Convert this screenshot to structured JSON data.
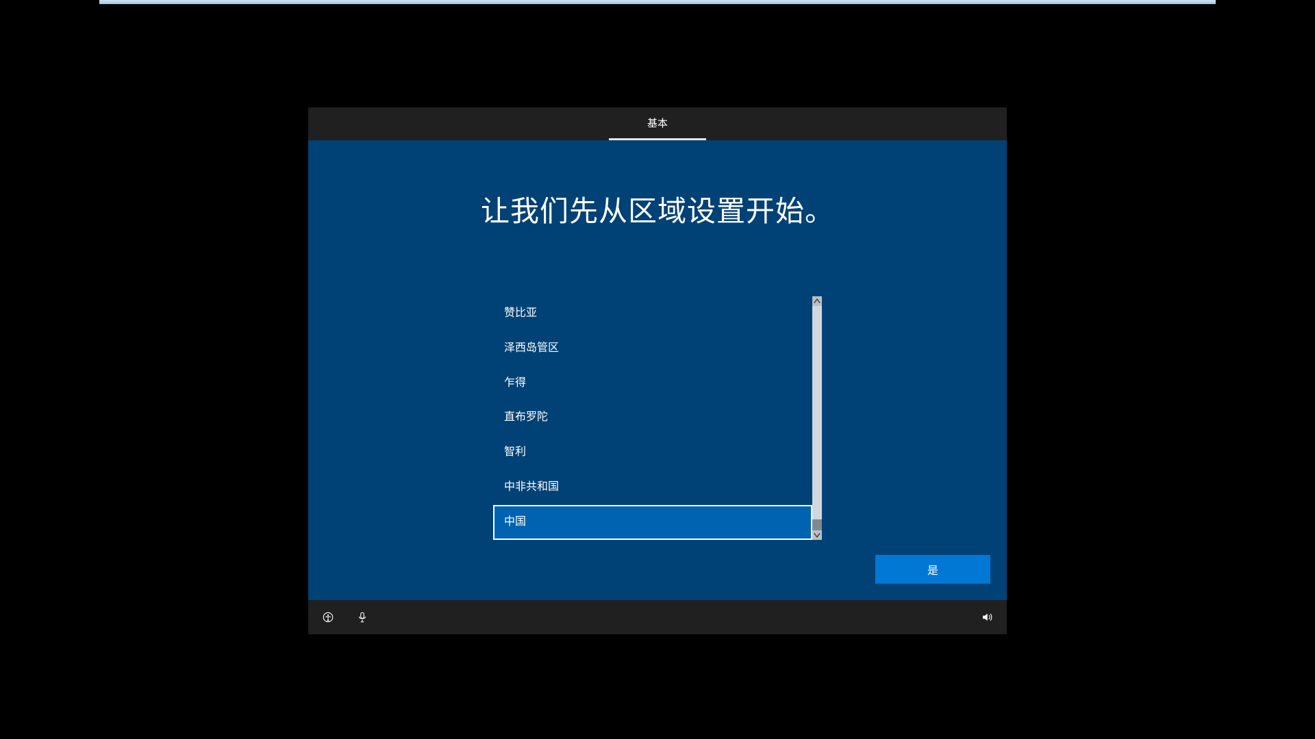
{
  "tab": {
    "label": "基本"
  },
  "heading": "让我们先从区域设置开始。",
  "regions": [
    {
      "label": "赞比亚",
      "selected": false
    },
    {
      "label": "泽西岛管区",
      "selected": false
    },
    {
      "label": "乍得",
      "selected": false
    },
    {
      "label": "直布罗陀",
      "selected": false
    },
    {
      "label": "智利",
      "selected": false
    },
    {
      "label": "中非共和国",
      "selected": false
    },
    {
      "label": "中国",
      "selected": true
    }
  ],
  "confirm": {
    "label": "是"
  }
}
